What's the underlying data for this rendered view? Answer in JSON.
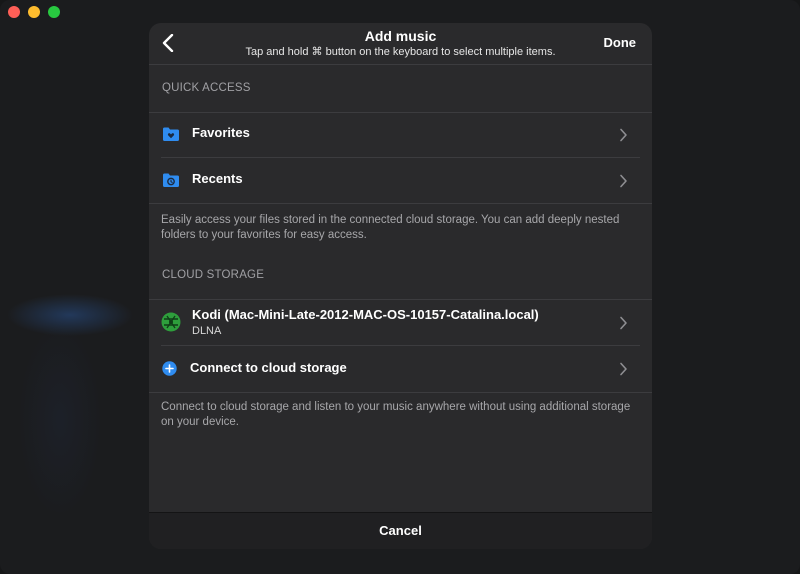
{
  "header": {
    "title": "Add music",
    "subtitle": "Tap and hold ⌘ button on the keyboard to select multiple items.",
    "done_label": "Done"
  },
  "quick_access": {
    "heading": "QUICK ACCESS",
    "items": [
      {
        "label": "Favorites",
        "icon": "favorites-folder-icon"
      },
      {
        "label": "Recents",
        "icon": "recents-folder-icon"
      }
    ],
    "note": "Easily access your files stored in the connected cloud storage. You can add deeply nested folders to your favorites for easy access."
  },
  "cloud_storage": {
    "heading": "CLOUD STORAGE",
    "items": [
      {
        "label": "Kodi (Mac-Mini-Late-2012-MAC-OS-10157-Catalina.local)",
        "sublabel": "DLNA",
        "icon": "dlna-server-icon"
      },
      {
        "label": "Connect to cloud storage",
        "icon": "plus-circle-icon"
      }
    ],
    "note": "Connect to cloud storage and listen to your music anywhere without using additional storage on your device."
  },
  "footer": {
    "cancel_label": "Cancel"
  },
  "colors": {
    "accent_blue": "#2f8cf0",
    "dlna_green": "#2e9e3c",
    "sheet_bg": "#2a2a2c"
  }
}
